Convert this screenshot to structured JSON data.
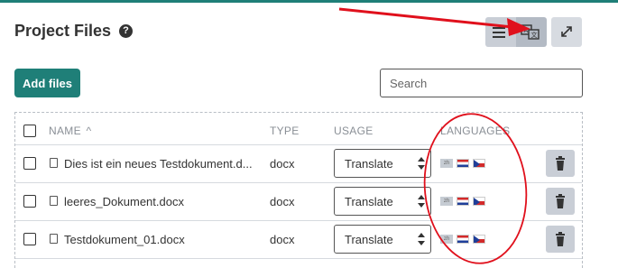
{
  "page": {
    "title": "Project Files"
  },
  "toolbar": {
    "add_label": "Add files",
    "search_placeholder": "Search"
  },
  "table": {
    "headers": {
      "name": "NAME",
      "sort_indicator": "^",
      "type": "TYPE",
      "usage": "USAGE",
      "languages": "LANGUAGES"
    },
    "rows": [
      {
        "name": "Dies ist ein neues Testdokument.d...",
        "type": "docx",
        "usage": "Translate"
      },
      {
        "name": "leeres_Dokument.docx",
        "type": "docx",
        "usage": "Translate"
      },
      {
        "name": "Testdokument_01.docx",
        "type": "docx",
        "usage": "Translate"
      }
    ]
  },
  "colors": {
    "accent": "#1f7f78",
    "annotation": "#e0101c"
  },
  "icons": [
    "help-icon",
    "list-view-icon",
    "language-view-icon",
    "expand-icon",
    "file-icon",
    "trash-icon",
    "source-language-flag",
    "croatia-flag",
    "czech-flag"
  ]
}
